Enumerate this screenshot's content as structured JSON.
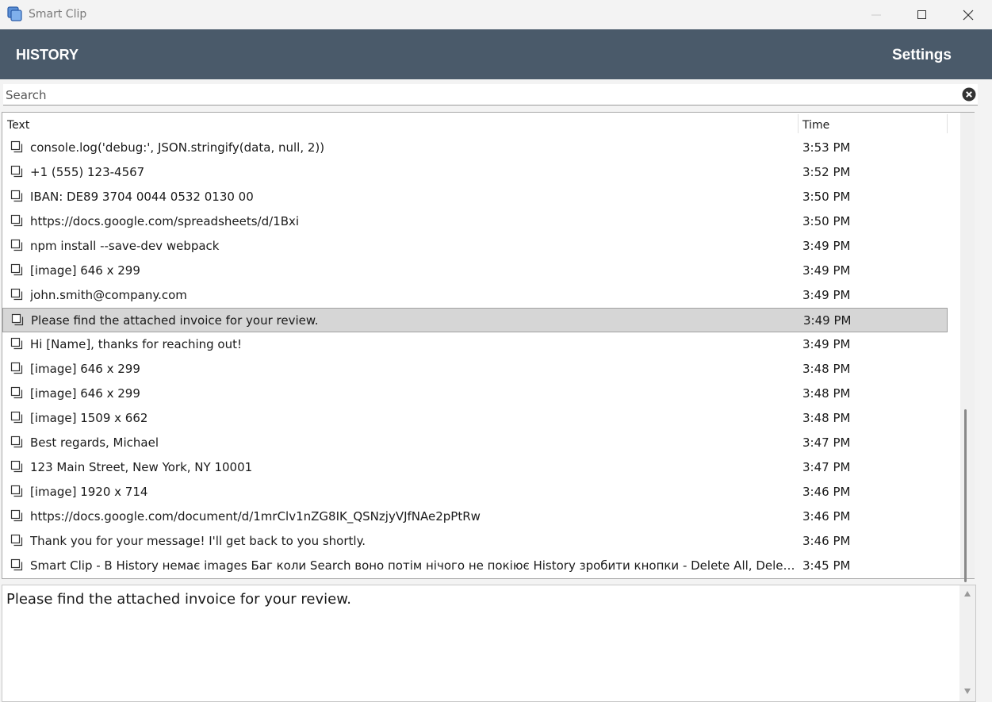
{
  "window": {
    "title": "Smart Clip"
  },
  "header": {
    "history_tab": "HISTORY",
    "settings_tab": "Settings"
  },
  "search": {
    "placeholder": "Search",
    "value": ""
  },
  "list": {
    "columns": {
      "text": "Text",
      "time": "Time"
    },
    "selected_index": 7,
    "rows": [
      {
        "text": "console.log('debug:', JSON.stringify(data, null, 2))",
        "time": "3:53 PM"
      },
      {
        "text": "+1 (555) 123-4567",
        "time": "3:52 PM"
      },
      {
        "text": "IBAN: DE89 3704 0044 0532 0130 00",
        "time": "3:50 PM"
      },
      {
        "text": "https://docs.google.com/spreadsheets/d/1Bxi",
        "time": "3:50 PM"
      },
      {
        "text": "npm install --save-dev webpack",
        "time": "3:49 PM"
      },
      {
        "text": "[image] 646 x 299",
        "time": "3:49 PM"
      },
      {
        "text": "john.smith@company.com",
        "time": "3:49 PM"
      },
      {
        "text": "Please find the attached invoice for your review.",
        "time": "3:49 PM"
      },
      {
        "text": "Hi [Name], thanks for reaching out!",
        "time": "3:49 PM"
      },
      {
        "text": "[image] 646 x 299",
        "time": "3:48 PM"
      },
      {
        "text": "[image] 646 x 299",
        "time": "3:48 PM"
      },
      {
        "text": "[image] 1509 x 662",
        "time": "3:48 PM"
      },
      {
        "text": "Best regards, Michael",
        "time": "3:47 PM"
      },
      {
        "text": "123 Main Street, New York, NY 10001",
        "time": "3:47 PM"
      },
      {
        "text": "[image] 1920 x 714",
        "time": "3:46 PM"
      },
      {
        "text": "https://docs.google.com/document/d/1mrClv1nZG8IK_QSNzjyVJfNAe2pPtRw",
        "time": "3:46 PM"
      },
      {
        "text": "Thank you for your message! I'll get back to you shortly.",
        "time": "3:46 PM"
      },
      {
        "text": "Smart Clip -  В History немає images Баг коли Search воно потім нічого не покіює History зробити кнопки - Delete All, Delete Item, Copy...",
        "time": "3:45 PM"
      }
    ]
  },
  "preview": {
    "text": "Please find the attached invoice for your review."
  },
  "colors": {
    "header_bg": "#4a5a6a",
    "selected_row": "#d6d6d6",
    "window_bg": "#f3f3f3"
  }
}
